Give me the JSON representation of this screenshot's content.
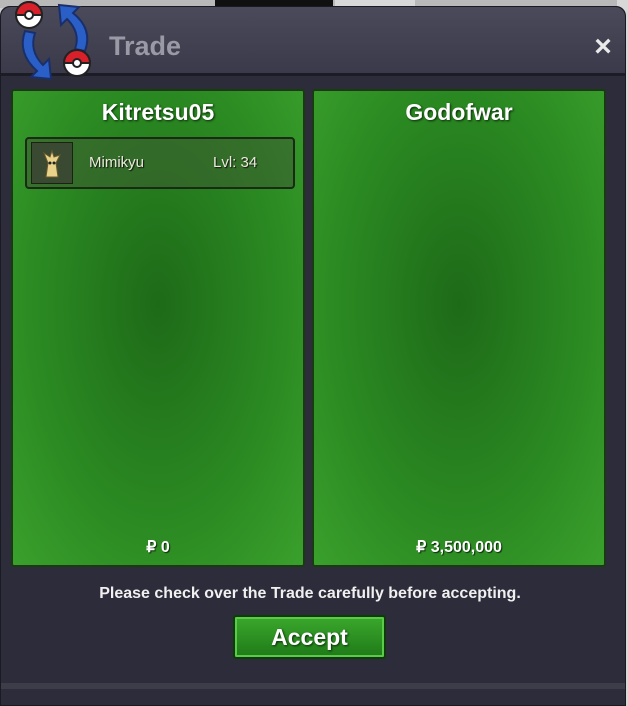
{
  "window": {
    "title": "Trade",
    "close_label": "×"
  },
  "icons": {
    "logo": "trade-pokeball-logo-icon",
    "close": "close-icon",
    "pokemon": "mimikyu-sprite-icon"
  },
  "colors": {
    "panel_green": "#2b8a22",
    "window_bg": "#2c2c3a",
    "accept_green": "#2f9a24"
  },
  "left_panel": {
    "player": "Kitretsu05",
    "items": [
      {
        "name": "Mimikyu",
        "level": "Lvl: 34"
      }
    ],
    "money": "₽ 0"
  },
  "right_panel": {
    "player": "Godofwar",
    "items": [],
    "money": "₽ 3,500,000"
  },
  "notice": "Please check over the Trade carefully before accepting.",
  "accept_label": "Accept"
}
